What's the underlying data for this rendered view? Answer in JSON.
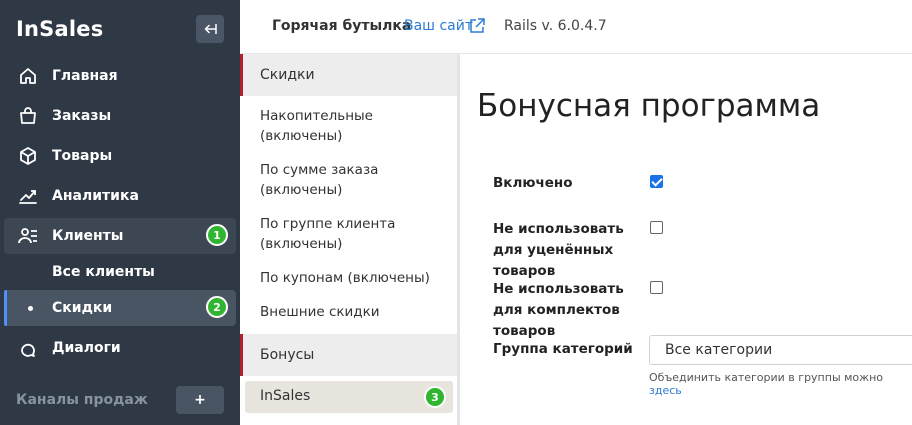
{
  "brand": {
    "logo": "InSales",
    "accent": "#4d90fe",
    "badge_color": "#2fb52f"
  },
  "sidebar": {
    "items": [
      {
        "label": "Главная",
        "icon": "home-icon"
      },
      {
        "label": "Заказы",
        "icon": "shopping-bag-icon"
      },
      {
        "label": "Товары",
        "icon": "box-icon"
      },
      {
        "label": "Аналитика",
        "icon": "chart-icon"
      },
      {
        "label": "Клиенты",
        "icon": "users-icon",
        "badge": "1"
      },
      {
        "label": "Диалоги",
        "icon": "chat-icon"
      }
    ],
    "subitems": [
      {
        "label": "Все клиенты"
      },
      {
        "label": "Скидки",
        "badge": "2"
      }
    ],
    "sales_channels": "Каналы продаж",
    "add_label": "+"
  },
  "header": {
    "store_name": "Горячая бутылка",
    "site_link": "Ваш сайт",
    "version": "Rails v. 6.0.4.7"
  },
  "discounts_menu": {
    "section1": "Скидки",
    "items": [
      "Накопительные (включены)",
      "По сумме заказа (включены)",
      "По группе клиента (включены)",
      "По купонам (включены)",
      "Внешние скидки"
    ],
    "section2": "Бонусы",
    "active_item": "InSales",
    "active_badge": "3"
  },
  "main": {
    "title": "Бонусная программа",
    "enabled_label": "Включено",
    "enabled": true,
    "no_discounted_label": "Не использовать для уценённых товаров",
    "no_discounted": false,
    "no_bundles_label": "Не использовать для комплектов товаров",
    "no_bundles": false,
    "category_group_label": "Группа категорий",
    "category_group_value": "Все категории",
    "hint_text": "Объединить категории в группы можно",
    "hint_link": "здесь"
  }
}
